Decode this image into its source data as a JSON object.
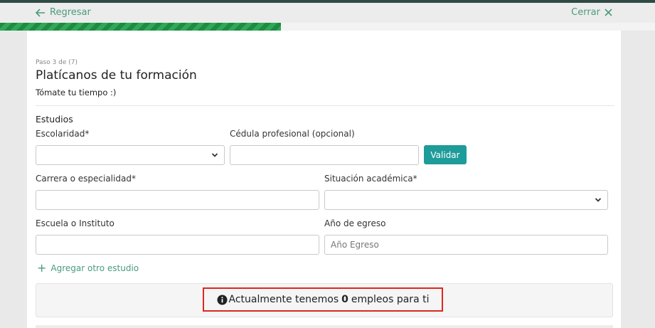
{
  "header": {
    "back_label": "Regresar",
    "close_label": "Cerrar",
    "progress_fraction": 0.4286
  },
  "form": {
    "step_text": "Paso 3 de (7)",
    "title": "Platícanos de tu formación",
    "subtitle": "Tómate tu tiempo :)",
    "section_title": "Estudios",
    "escolaridad": {
      "label": "Escolaridad*",
      "value": ""
    },
    "cedula": {
      "label": "Cédula profesional (opcional)",
      "value": ""
    },
    "validate_label": "Validar",
    "carrera": {
      "label": "Carrera o especialidad*",
      "value": ""
    },
    "situacion": {
      "label": "Situación académica*",
      "value": ""
    },
    "escuela": {
      "label": "Escuela o Instituto",
      "value": ""
    },
    "anio": {
      "label": "Año de egreso",
      "placeholder": "Año Egreso"
    },
    "add_study_label": "Agregar otro estudio"
  },
  "jobs": {
    "prefix": "Actualmente tenemos",
    "count": "0",
    "suffix": "empleos para ti"
  },
  "colors": {
    "accent_green": "#4a9b7d",
    "progress_green": "#1f8a43",
    "button_teal": "#1e9c99",
    "highlight_red": "#e0261f"
  }
}
